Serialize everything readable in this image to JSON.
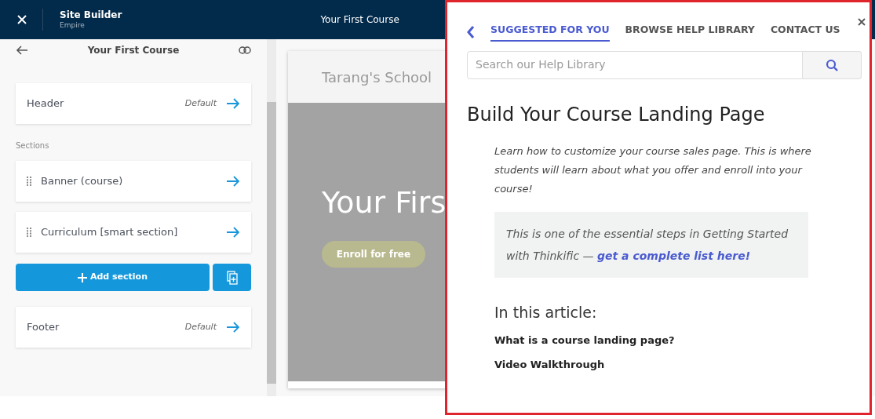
{
  "top_bar": {
    "title": "Site Builder",
    "subtitle": "Empire",
    "page_title": "Your First Course"
  },
  "sidebar": {
    "title": "Your First Course",
    "header": {
      "label": "Header",
      "tag": "Default"
    },
    "sections_label": "Sections",
    "sections": [
      {
        "label": "Banner (course)"
      },
      {
        "label": "Curriculum [smart section]"
      }
    ],
    "add_button": "Add section",
    "footer": {
      "label": "Footer",
      "tag": "Default"
    }
  },
  "preview": {
    "school_name": "Tarang's School",
    "banner_title": "Your Firs",
    "enroll_button": "Enroll for free"
  },
  "help_panel": {
    "tabs": [
      {
        "label": "SUGGESTED FOR YOU",
        "selected": true
      },
      {
        "label": "BROWSE HELP LIBRARY",
        "selected": false
      },
      {
        "label": "CONTACT US",
        "selected": false
      }
    ],
    "search": {
      "placeholder": "Search our Help Library"
    },
    "article": {
      "title": "Build Your Course Landing Page",
      "intro": "Learn how to customize your course sales page. This is where students will learn about what you offer and enroll into your course!",
      "callout": "This is one of the essential steps in Getting Started with Thinkific — ",
      "callout_link": "get a complete list here!",
      "toc_heading": "In this article:",
      "toc": [
        "What is a course landing page?",
        "Video Walkthrough"
      ]
    }
  }
}
